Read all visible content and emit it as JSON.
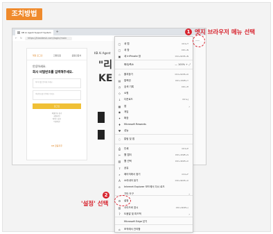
{
  "badge_label": "조치방법",
  "annotations": {
    "step1_num": "1",
    "step1_text": "엣지 브라우저 메뉴 선택",
    "step2_num": "2",
    "step2_text": "'설정' 선택"
  },
  "browser": {
    "tab_title": "KB Ai Agent Support System",
    "url": "https://kbaidesk.com/login/main",
    "login": {
      "tabs": [
        "계정 로그인",
        "간편인증",
        "공동인증서"
      ],
      "greeting": "안녕하세요.",
      "headline": "회사 비밀번호를 입력해주세요.",
      "id_placeholder": "아이디를 입력해 주세요.",
      "pw_placeholder": "비밀번호를 입력해 주세요.",
      "login_button": "로그인",
      "links": [
        "비밀번호 찾기",
        "회원가입",
        "아이디 찾기",
        "이용약관"
      ],
      "footer": "KB 금융지주"
    },
    "bg_text": [
      "KB Ai Agent",
      "\"리",
      "KE"
    ]
  },
  "menu": {
    "items": [
      {
        "label": "새 탭",
        "shortcut": "Ctrl+T",
        "icon": "▢"
      },
      {
        "label": "새 창",
        "shortcut": "Ctrl+N",
        "icon": "▢"
      },
      {
        "label": "새 InPrivate 창",
        "shortcut": "Ctrl+Shift+N",
        "icon": "▣"
      },
      {
        "label": "확대/축소",
        "shortcut": "",
        "icon": "",
        "zoom": "—   100%  +  ⤢"
      },
      {
        "label": "즐겨찾기",
        "shortcut": "Ctrl+Shift+O",
        "icon": "☆"
      },
      {
        "label": "컬렉션",
        "shortcut": "Ctrl+Shift+Y",
        "icon": "▤"
      },
      {
        "label": "검색 기록",
        "shortcut": "Ctrl+H",
        "icon": "◷"
      },
      {
        "label": "쇼핑",
        "shortcut": "",
        "icon": "◇"
      },
      {
        "label": "다운로드",
        "shortcut": "Ctrl+J",
        "icon": "↓"
      },
      {
        "label": "앱",
        "shortcut": "",
        "icon": "▦",
        "arrow": true
      },
      {
        "label": "게임",
        "shortcut": "",
        "icon": "◉"
      },
      {
        "label": "확장",
        "shortcut": "",
        "icon": "✦"
      },
      {
        "label": "Microsoft Rewards",
        "shortcut": "",
        "icon": "♦"
      },
      {
        "label": "성능",
        "shortcut": "",
        "icon": "♥"
      },
      {
        "label": "알림 및 앱",
        "shortcut": "",
        "icon": "◌"
      },
      {
        "label": "인쇄",
        "shortcut": "Ctrl+P",
        "icon": "⎙"
      },
      {
        "label": "웹 캡처",
        "shortcut": "Ctrl+Shift+S",
        "icon": "✂"
      },
      {
        "label": "웹 선택",
        "shortcut": "Ctrl+Shift+X",
        "icon": "▧"
      },
      {
        "label": "공유",
        "shortcut": "",
        "icon": "⇪"
      },
      {
        "label": "페이지에서 찾기",
        "shortcut": "Ctrl+F",
        "icon": "⌕"
      },
      {
        "label": "소리내어 읽기",
        "shortcut": "Ctrl+Shift+U",
        "icon": "A"
      },
      {
        "label": "Internet Explorer 모드에서 다시 로드",
        "shortcut": "",
        "icon": "e"
      },
      {
        "label": "기타 도구",
        "shortcut": "",
        "icon": "",
        "arrow": true
      },
      {
        "label": "설정",
        "shortcut": "",
        "icon": "⚙"
      },
      {
        "label": "사이드바 표시",
        "shortcut": "Ctrl+Shift+/",
        "icon": "▥"
      },
      {
        "label": "도움말 및 피드백",
        "shortcut": "",
        "icon": "?",
        "arrow": true
      },
      {
        "label": "Microsoft Edge 닫기",
        "shortcut": "",
        "icon": ""
      },
      {
        "label": "조직에서 관리함",
        "shortcut": "",
        "icon": "⌂"
      }
    ]
  },
  "colors": {
    "badge": "#ef8a2c",
    "accent_red": "#d7232e",
    "login_button": "#f0c036"
  }
}
